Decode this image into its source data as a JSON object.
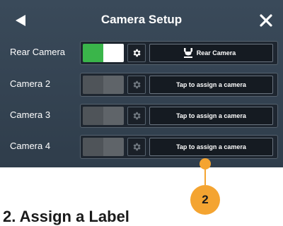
{
  "header": {
    "title": "Camera Setup"
  },
  "rows": [
    {
      "label": "Rear Camera",
      "toggle_on": true,
      "button": "Rear Camera"
    },
    {
      "label": "Camera 2",
      "toggle_on": false,
      "button": "Tap to assign a camera"
    },
    {
      "label": "Camera 3",
      "toggle_on": false,
      "button": "Tap to assign a camera"
    },
    {
      "label": "Camera 4",
      "toggle_on": false,
      "button": "Tap to assign a camera"
    }
  ],
  "callout": {
    "number": "2"
  },
  "footer": {
    "heading": "2. Assign a Label"
  },
  "colors": {
    "panel": "#2f3d4b",
    "toggle_on": "#3ab54a",
    "toggle_off": "#5f6469",
    "accent": "#f4a431"
  },
  "icons": [
    "back-arrow-icon",
    "close-icon",
    "gear-icon",
    "camera-icon"
  ]
}
